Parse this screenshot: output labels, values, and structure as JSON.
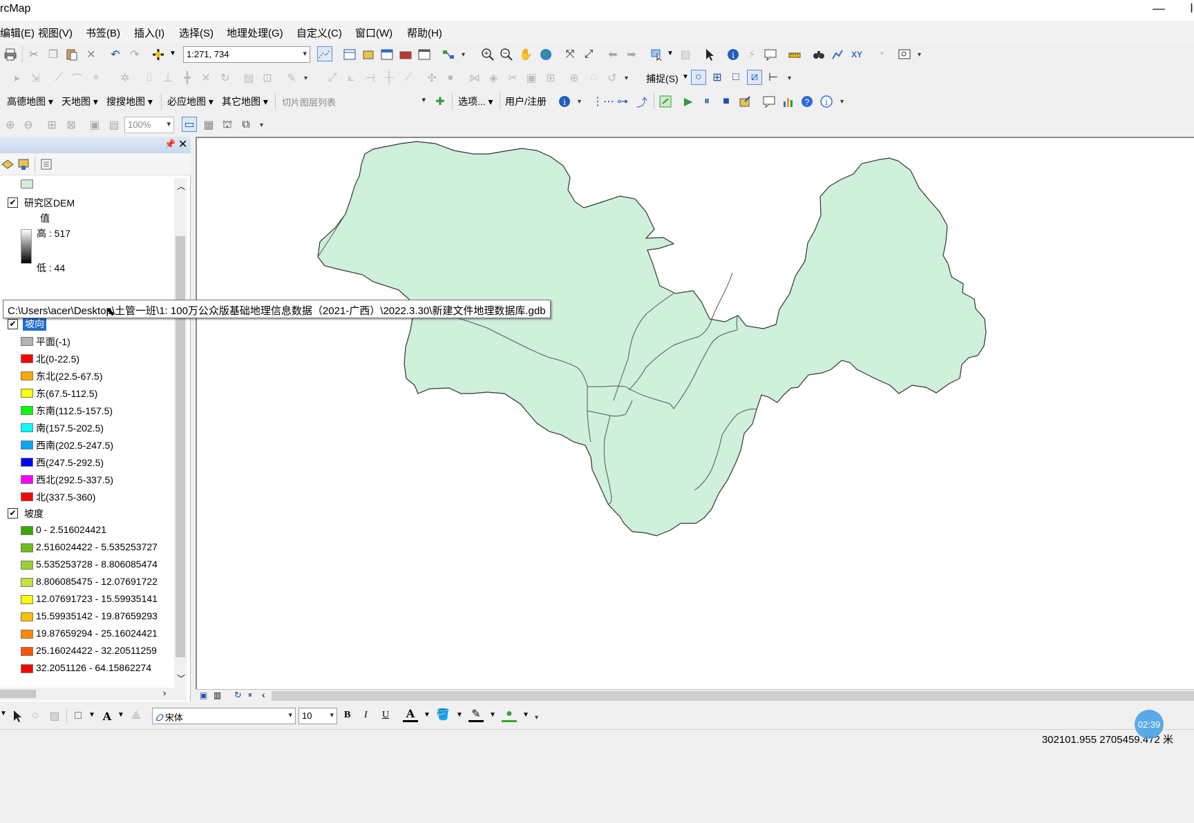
{
  "window": {
    "title": "rcMap",
    "minimize": "—",
    "close": "I"
  },
  "menu": [
    "编辑(E)",
    "视图(V)",
    "书签(B)",
    "插入(I)",
    "选择(S)",
    "地理处理(G)",
    "自定义(C)",
    "窗口(W)",
    "帮助(H)"
  ],
  "toolbar": {
    "scale": "1:271, 734",
    "snapping_label": "捕捉(S)",
    "basemaps": [
      "高德地图",
      "天地图",
      "搜搜地图",
      "必应地图",
      "其它地图"
    ],
    "tile_layer_placeholder": "切片图层列表",
    "options_label": "选项...",
    "user_register_label": "用户/注册",
    "zoom_percent": "100%"
  },
  "toc": {
    "layers": {
      "dem": {
        "name": "研究区DEM",
        "value_label": "值",
        "high": "高 : 517",
        "low": "低 : 44"
      },
      "aspect": {
        "name": "坡向",
        "classes": [
          {
            "label": "平面(-1)",
            "color": "#b2b2b2"
          },
          {
            "label": "北(0-22.5)",
            "color": "#ff0000"
          },
          {
            "label": "东北(22.5-67.5)",
            "color": "#ffa500"
          },
          {
            "label": "东(67.5-112.5)",
            "color": "#ffff00"
          },
          {
            "label": "东南(112.5-157.5)",
            "color": "#00ff00"
          },
          {
            "label": "南(157.5-202.5)",
            "color": "#00ffff"
          },
          {
            "label": "西南(202.5-247.5)",
            "color": "#00a6ff"
          },
          {
            "label": "西(247.5-292.5)",
            "color": "#0000ff"
          },
          {
            "label": "西北(292.5-337.5)",
            "color": "#ff00ff"
          },
          {
            "label": "北(337.5-360)",
            "color": "#ff0000"
          }
        ]
      },
      "slope": {
        "name": "坡度",
        "classes": [
          {
            "label": "0 - 2.516024421",
            "color": "#38a800"
          },
          {
            "label": "2.516024422 - 5.535253727",
            "color": "#6fbf1b"
          },
          {
            "label": "5.535253728 - 8.806085474",
            "color": "#9bd12e"
          },
          {
            "label": "8.806085475 - 12.07691722",
            "color": "#c6e33a"
          },
          {
            "label": "12.07691723 - 15.59935141",
            "color": "#ffff00"
          },
          {
            "label": "15.59935142 - 19.87659293",
            "color": "#ffc000"
          },
          {
            "label": "19.87659294 - 25.16024421",
            "color": "#ff8a00"
          },
          {
            "label": "25.16024422 - 32.20511259",
            "color": "#ff5500"
          },
          {
            "label": "32.2051126 - 64.15862274",
            "color": "#ff0000"
          }
        ]
      }
    },
    "top_swatch_color": "#d3ecdb"
  },
  "tooltip": "C:\\Users\\acer\\Desktop\\土管一班\\1:  100万公众版基础地理信息数据（2021-广西）\\2022.3.30\\新建文件地理数据库.gdb",
  "map": {
    "fill_color": "#cff0da",
    "outline_color": "#555555"
  },
  "drawing": {
    "font_name": "宋体",
    "font_size": "10",
    "bold": "B",
    "italic": "I",
    "underline": "U"
  },
  "status": {
    "coordinates": "302101.955  2705459.472 米"
  },
  "timer": "02:39"
}
